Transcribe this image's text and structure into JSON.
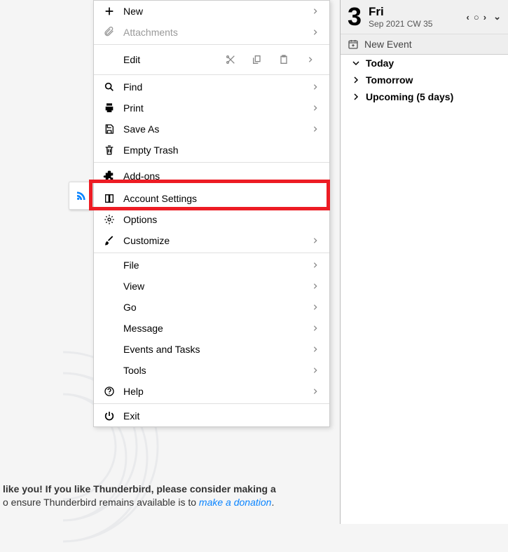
{
  "menu": {
    "new": "New",
    "attachments": "Attachments",
    "edit": "Edit",
    "find": "Find",
    "print": "Print",
    "saveAs": "Save As",
    "emptyTrash": "Empty Trash",
    "addons": "Add-ons",
    "accountSettings": "Account Settings",
    "options": "Options",
    "customize": "Customize",
    "file": "File",
    "view": "View",
    "go": "Go",
    "message": "Message",
    "eventsTasks": "Events and Tasks",
    "tools": "Tools",
    "help": "Help",
    "exit": "Exit"
  },
  "calendar": {
    "dayNum": "3",
    "dayName": "Fri",
    "sub": "Sep 2021  CW 35",
    "newEvent": "New Event",
    "today": "Today",
    "tomorrow": "Tomorrow",
    "upcoming": "Upcoming (5 days)"
  },
  "footer": {
    "line1a": "like you! If you like Thunderbird, please consider making a ",
    "line2a": "o ensure Thunderbird remains available is to ",
    "link": "make a donation",
    "line2b": "."
  }
}
